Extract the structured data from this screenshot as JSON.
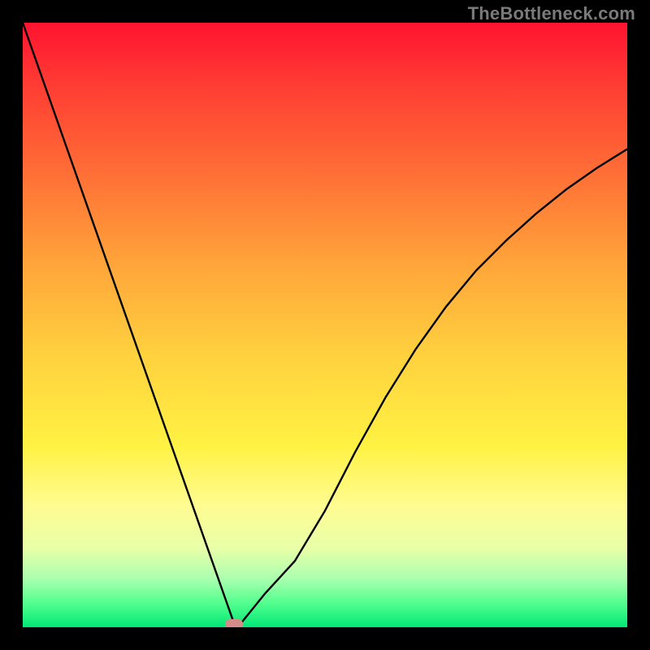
{
  "watermark": "TheBottleneck.com",
  "chart_data": {
    "type": "line",
    "title": "",
    "xlabel": "",
    "ylabel": "",
    "xlim": [
      0,
      100
    ],
    "ylim": [
      0,
      100
    ],
    "legend": false,
    "grid": false,
    "background": "red-yellow-green vertical gradient",
    "series": [
      {
        "name": "bottleneck-curve",
        "x": [
          0,
          5,
          10,
          15,
          20,
          25,
          30,
          33,
          35,
          38,
          40,
          45,
          50,
          55,
          60,
          65,
          70,
          75,
          80,
          85,
          90,
          95,
          100
        ],
        "y": [
          100,
          85.3,
          70.6,
          55.9,
          41.2,
          26.5,
          11.8,
          3,
          0.5,
          3.5,
          8,
          19,
          29,
          38,
          46,
          53,
          59,
          64,
          68.5,
          72.5,
          76,
          79,
          81.5
        ]
      }
    ],
    "minimum_marker": {
      "x": 35,
      "y": 0.5,
      "color": "#d58b87"
    },
    "notes": "V-shaped curve reaching minimum near x≈35; right branch asymptotically rises. Axis values estimated from shape (no tick labels visible)."
  }
}
